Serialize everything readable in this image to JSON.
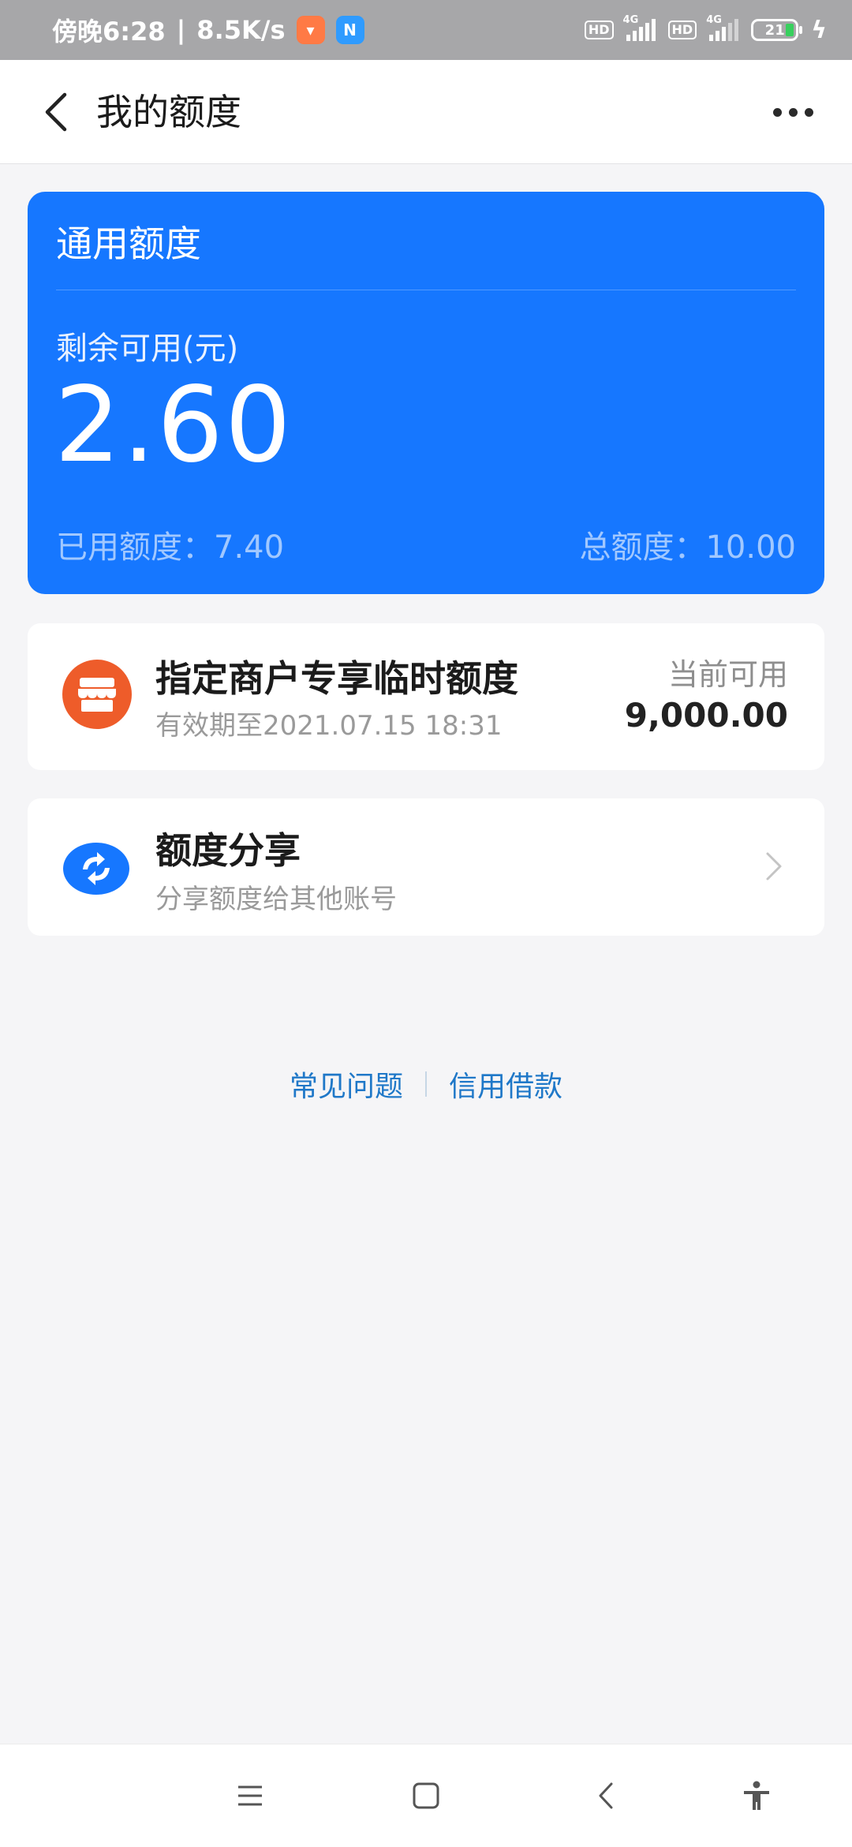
{
  "status_bar": {
    "time": "傍晚6:28",
    "speed": "8.5K/s",
    "hd1": "HD",
    "gen1": "4G",
    "hd2": "HD",
    "gen2": "4G",
    "battery": "21",
    "app_badge_colors": [
      "#ff7a45",
      "#2f9bff"
    ]
  },
  "header": {
    "title": "我的额度"
  },
  "quota": {
    "title": "通用额度",
    "remain_label": "剩余可用(元)",
    "remain_value": "2.60",
    "used_label": "已用额度：",
    "used_value": "7.40",
    "total_label": "总额度：",
    "total_value": "10.00",
    "color": "#1677ff"
  },
  "merchant": {
    "title": "指定商户专享临时额度",
    "validity": "有效期至2021.07.15 18:31",
    "avail_label": "当前可用",
    "avail_value": "9,000.00",
    "icon": "store-icon",
    "icon_color": "#ee5c2a"
  },
  "share": {
    "title": "额度分享",
    "subtitle": "分享额度给其他账号",
    "icon": "share-exchange-icon"
  },
  "links": {
    "faq": "常见问题",
    "credit_loan": "信用借款",
    "color": "#1f78c8"
  },
  "nav": {
    "icons": [
      "menu-icon",
      "home-icon",
      "back-icon",
      "accessibility-icon"
    ]
  }
}
